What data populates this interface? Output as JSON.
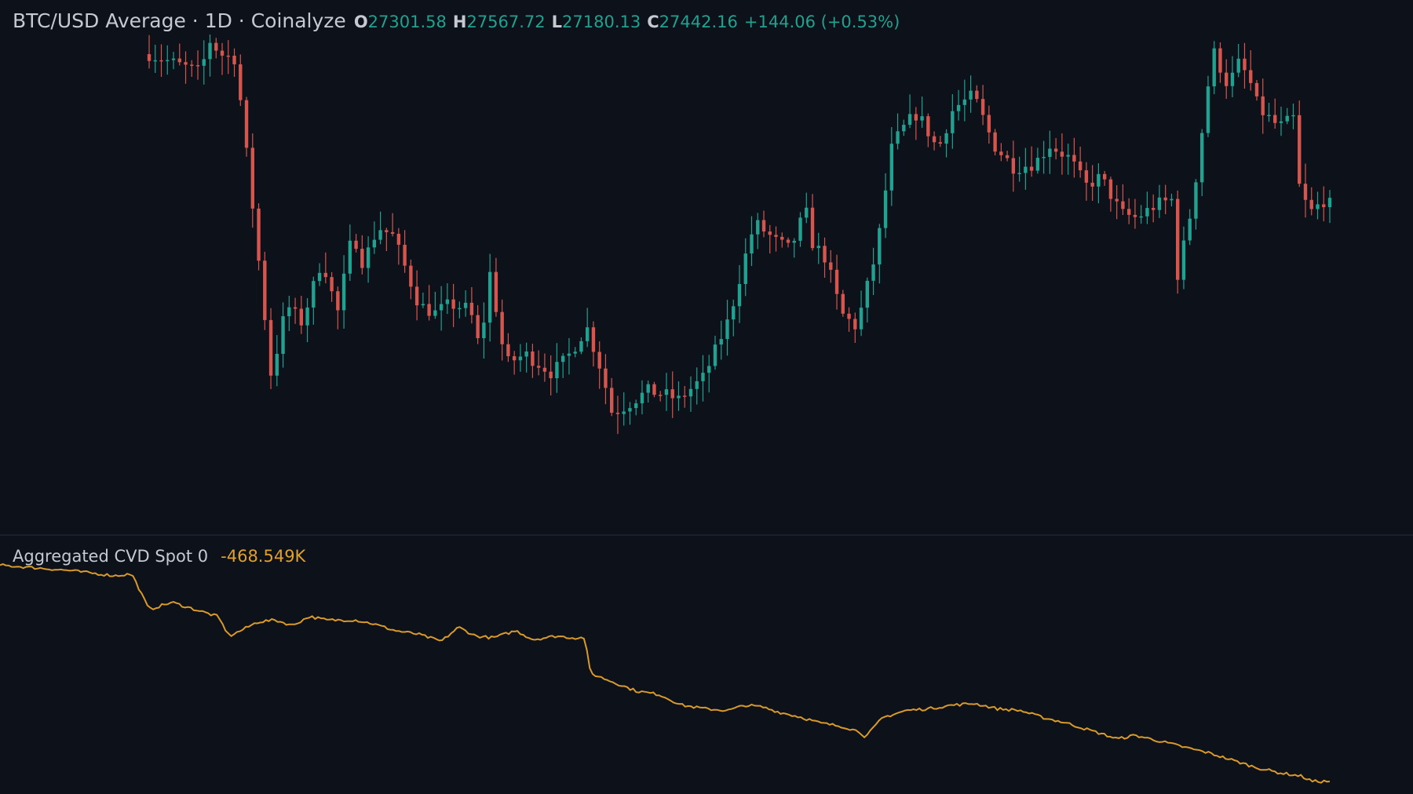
{
  "colors": {
    "background": "#0c111a",
    "up": "#22a090",
    "down": "#d4564e",
    "cvd_line": "#d99a2b",
    "divider": "#262d39",
    "text": "#c6c9d0"
  },
  "legend": {
    "title": "BTC/USD Average · 1D · Coinalyze",
    "open_label": "O",
    "open": "27301.58",
    "high_label": "H",
    "high": "27567.72",
    "low_label": "L",
    "low": "27180.13",
    "close_label": "C",
    "close": "27442.16",
    "change": "+144.06 (+0.53%)"
  },
  "cvd_legend": {
    "title": "Aggregated CVD Spot 0",
    "value": "-468.549K"
  },
  "chart_data": [
    {
      "type": "candlestick",
      "title": "BTC/USD Average · 1D · Coinalyze",
      "bars": 195,
      "ylim": [
        0,
        100
      ],
      "path": [
        [
          0,
          95
        ],
        [
          10,
          91
        ],
        [
          12,
          98
        ],
        [
          14,
          95
        ],
        [
          17,
          94
        ],
        [
          21,
          55
        ],
        [
          24,
          24
        ],
        [
          27,
          40
        ],
        [
          30,
          36
        ],
        [
          34,
          50
        ],
        [
          37,
          38
        ],
        [
          40,
          56
        ],
        [
          42,
          49
        ],
        [
          45,
          57
        ],
        [
          48,
          55
        ],
        [
          53,
          40
        ],
        [
          56,
          38
        ],
        [
          59,
          40
        ],
        [
          63,
          39
        ],
        [
          65,
          30
        ],
        [
          67,
          47
        ],
        [
          70,
          27
        ],
        [
          74,
          29
        ],
        [
          79,
          25
        ],
        [
          82,
          28
        ],
        [
          86,
          35
        ],
        [
          89,
          25
        ],
        [
          91,
          16
        ],
        [
          94,
          18
        ],
        [
          98,
          21
        ],
        [
          102,
          20
        ],
        [
          104,
          19
        ],
        [
          106,
          21
        ],
        [
          109,
          24
        ],
        [
          114,
          37
        ],
        [
          117,
          50
        ],
        [
          119,
          58
        ],
        [
          123,
          54
        ],
        [
          126,
          52
        ],
        [
          129,
          61
        ],
        [
          130,
          54
        ],
        [
          133,
          50
        ],
        [
          136,
          38
        ],
        [
          139,
          35
        ],
        [
          143,
          52
        ],
        [
          146,
          75
        ],
        [
          149,
          80
        ],
        [
          151,
          82
        ],
        [
          155,
          74
        ],
        [
          158,
          83
        ],
        [
          162,
          86
        ],
        [
          166,
          75
        ],
        [
          170,
          70
        ],
        [
          174,
          71
        ],
        [
          177,
          75
        ],
        [
          181,
          72
        ],
        [
          184,
          66
        ],
        [
          187,
          68
        ],
        [
          191,
          60
        ],
        [
          194,
          59
        ],
        [
          198,
          62
        ],
        [
          201,
          63
        ],
        [
          202,
          46
        ],
        [
          205,
          62
        ],
        [
          209,
          96
        ],
        [
          212,
          88
        ],
        [
          214,
          93
        ],
        [
          216,
          90
        ],
        [
          218,
          83
        ],
        [
          220,
          81
        ],
        [
          222,
          79
        ],
        [
          225,
          81
        ],
        [
          226,
          66
        ],
        [
          228,
          60
        ],
        [
          231,
          63
        ],
        [
          232,
          62
        ]
      ]
    },
    {
      "type": "line",
      "title": "Aggregated CVD Spot 0",
      "series": [
        {
          "name": "Aggregated CVD Spot 0",
          "values_note": ""
        }
      ],
      "ylim": [
        0,
        100
      ],
      "points": [
        [
          0,
          99
        ],
        [
          12,
          96
        ],
        [
          20,
          93
        ],
        [
          23,
          94
        ],
        [
          26,
          74
        ],
        [
          30,
          78
        ],
        [
          34,
          74
        ],
        [
          38,
          70
        ],
        [
          40,
          59
        ],
        [
          42,
          62
        ],
        [
          45,
          67
        ],
        [
          48,
          68
        ],
        [
          51,
          65
        ],
        [
          54,
          70
        ],
        [
          57,
          68
        ],
        [
          62,
          68
        ],
        [
          65,
          66
        ],
        [
          69,
          62
        ],
        [
          73,
          60
        ],
        [
          77,
          56
        ],
        [
          80,
          64
        ],
        [
          83,
          59
        ],
        [
          86,
          58
        ],
        [
          90,
          62
        ],
        [
          93,
          57
        ],
        [
          97,
          59
        ],
        [
          100,
          58
        ],
        [
          102,
          58
        ],
        [
          103,
          38
        ],
        [
          107,
          33
        ],
        [
          111,
          28
        ],
        [
          115,
          26
        ],
        [
          119,
          20
        ],
        [
          123,
          18
        ],
        [
          127,
          17
        ],
        [
          130,
          20
        ],
        [
          133,
          19
        ],
        [
          136,
          16
        ],
        [
          140,
          13
        ],
        [
          143,
          10
        ],
        [
          147,
          8
        ],
        [
          150,
          5
        ],
        [
          151,
          2
        ],
        [
          154,
          13
        ],
        [
          158,
          17
        ],
        [
          162,
          18
        ],
        [
          166,
          20
        ],
        [
          170,
          21
        ],
        [
          174,
          18
        ],
        [
          178,
          17
        ],
        [
          182,
          13
        ],
        [
          186,
          10
        ],
        [
          190,
          6
        ],
        [
          193,
          3
        ],
        [
          195,
          1
        ],
        [
          198,
          3
        ],
        [
          202,
          0
        ],
        [
          207,
          -4
        ],
        [
          211,
          -7
        ],
        [
          215,
          -11
        ],
        [
          219,
          -15
        ],
        [
          223,
          -18
        ],
        [
          227,
          -20
        ],
        [
          229,
          -23
        ],
        [
          232,
          -23
        ]
      ]
    }
  ]
}
